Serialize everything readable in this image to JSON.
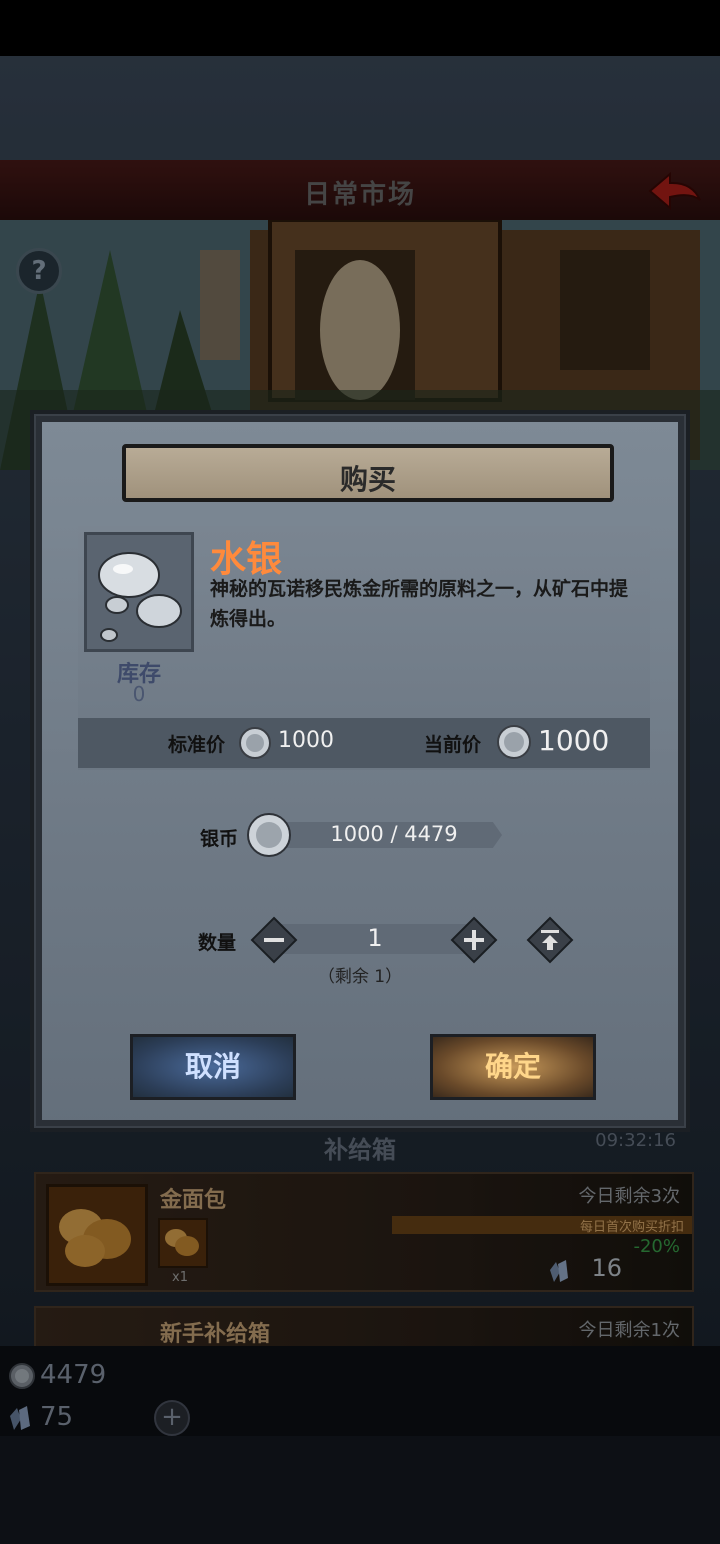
{
  "header": {
    "title": "日常市场"
  },
  "shop": {
    "section_title": "补给箱",
    "timer": "09:32:16",
    "items": [
      {
        "name": "金面包",
        "remain": "今日剩余3次",
        "ribbon": "每日首次购买折扣",
        "discount": "-20%",
        "price": "16",
        "qty": "x1"
      },
      {
        "name": "新手补给箱",
        "remain": "今日剩余1次"
      }
    ]
  },
  "wallet": {
    "silver": "4479",
    "crystal": "75"
  },
  "dialog": {
    "title": "购买",
    "item": {
      "name": "水银",
      "description": "神秘的瓦诺移民炼金所需的原料之一，从矿石中提炼得出。",
      "stock_label": "库存",
      "stock_value": "0"
    },
    "standard_price_label": "标准价",
    "standard_price": "1000",
    "current_price_label": "当前价",
    "current_price": "1000",
    "silver_label": "银币",
    "silver_value": "1000 / 4479",
    "quantity_label": "数量",
    "quantity": "1",
    "remaining_note": "（剩余 1）",
    "cancel_label": "取消",
    "confirm_label": "确定"
  },
  "colors": {
    "item_name": "#ff8a3c",
    "cancel": "#2c3e58",
    "confirm": "#6a4a2a"
  },
  "icons": [
    "back-arrow-icon",
    "help-icon",
    "mercury-icon",
    "silver-coin-icon",
    "crystal-icon",
    "minus-icon",
    "plus-icon",
    "max-icon",
    "bread-icon"
  ]
}
